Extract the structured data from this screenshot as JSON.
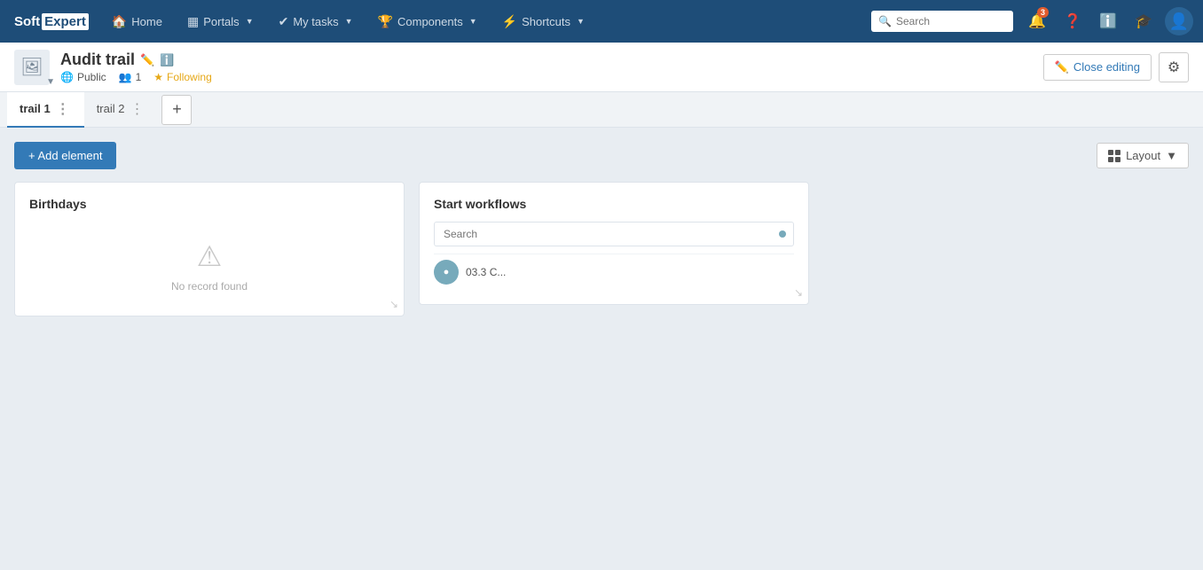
{
  "navbar": {
    "brand_soft": "Soft",
    "brand_expert": "Expert",
    "home_label": "Home",
    "portals_label": "Portals",
    "my_tasks_label": "My tasks",
    "components_label": "Components",
    "shortcuts_label": "Shortcuts",
    "search_placeholder": "Search",
    "notification_badge": "3"
  },
  "subheader": {
    "title": "Audit trail",
    "visibility": "Public",
    "members_count": "1",
    "following_label": "Following",
    "close_editing_label": "Close editing"
  },
  "tabs": {
    "tab1_label": "trail 1",
    "tab2_label": "trail 2"
  },
  "toolbar": {
    "add_element_label": "+ Add element",
    "layout_label": "Layout"
  },
  "widgets": {
    "birthdays": {
      "title": "Birthdays",
      "empty_text": "No record found"
    },
    "workflows": {
      "title": "Start workflows",
      "search_placeholder": "Search",
      "list_item_text": "03.3 C..."
    }
  }
}
